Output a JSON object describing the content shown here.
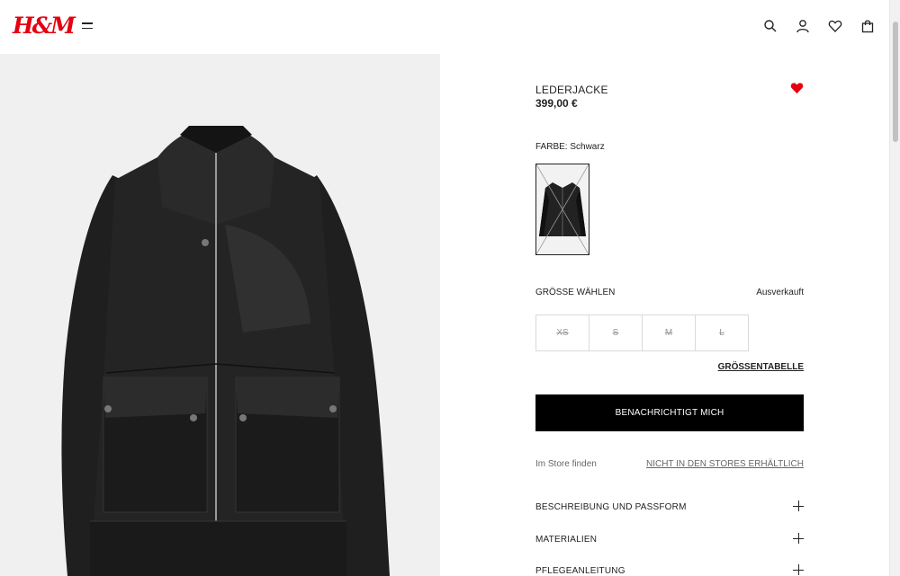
{
  "header": {
    "logo": "H&M",
    "icons": [
      "search-icon",
      "account-icon",
      "favorites-icon",
      "shopping-bag-icon"
    ]
  },
  "product": {
    "title": "LEDERJACKE",
    "price": "399,00 €",
    "color_label": "FARBE: Schwarz",
    "size_label": "GRÖSSE WÄHLEN",
    "availability": "Ausverkauft",
    "sizes": [
      "XS",
      "S",
      "M",
      "L"
    ],
    "size_chart": "GRÖSSENTABELLE",
    "notify_button": "BENACHRICHTIGT MICH",
    "store_find": "Im Store finden",
    "store_availability": "NICHT IN DEN STORES ERHÄLTLICH",
    "accordions": [
      "BESCHREIBUNG UND PASSFORM",
      "MATERIALIEN",
      "PFLEGEANLEITUNG"
    ]
  },
  "colors": {
    "brand_red": "#e50010",
    "button_black": "#000000",
    "image_background": "#f0f0f0"
  }
}
